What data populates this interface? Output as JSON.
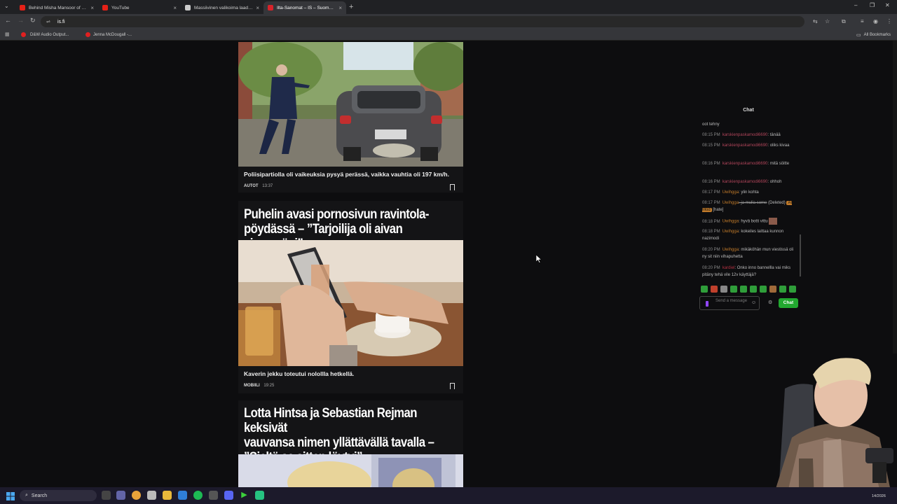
{
  "tabs": [
    {
      "title": "Behind Misha Mansoor of Periphery",
      "favicon_color": "#e62117",
      "active": false
    },
    {
      "title": "YouTube",
      "favicon_color": "#e62117",
      "active": false
    },
    {
      "title": "Massiivinen valikoima laadukkaita",
      "favicon_color": "#cccccc",
      "active": false
    },
    {
      "title": "Ilta-Sanomat – IS – Suomen suurin",
      "favicon_color": "#d8232a",
      "active": true
    }
  ],
  "address": {
    "url": "is.fi"
  },
  "bookmarks": [
    {
      "label": "D&W Audio Output..."
    },
    {
      "label": "Jenna McDougall -..."
    }
  ],
  "bookmarks_all": "All Bookmarks",
  "articles": [
    {
      "caption": "Poliisipartiolla oli vaikeuksia pysyä perässä, vaikka vauhtia oli 197 km/h.",
      "category": "AUTOT",
      "time": "13:37"
    },
    {
      "headline": "Puhelin avasi pornosivun ravintola-pöydässä – ”Tarjoilija oli aivan vieressäni”",
      "headline_line1": "Puhelin avasi pornosivun ravintola-",
      "headline_line2": "pöydässä – ”Tarjoilija oli aivan vieressäni”",
      "caption": "Kaverin jekku toteutui nolollla hetkellä.",
      "category": "MOBIILI",
      "time": "19:25"
    },
    {
      "headline_line1": "Lotta Hintsa ja Sebastian Rejman keksivät",
      "headline_line2": "vauvansa nimen yllättävällä tavalla –",
      "headline_line3": "”Sieltä se sitten löytyi”"
    }
  ],
  "chat": {
    "title": "Chat",
    "messages": [
      {
        "ts": "",
        "user": "",
        "text": "oot tehny"
      },
      {
        "ts": "08:15 PM",
        "user": "karskienpaskamodi6690",
        "text": ": tänää"
      },
      {
        "ts": "08:15 PM",
        "user": "karskienpaskamodi6690",
        "text": ": oliks kivaa"
      },
      {
        "ts": "08:16 PM",
        "user": "karskienpaskamodi6690",
        "text": ": mitä söitte"
      },
      {
        "ts": "08:16 PM",
        "user": "karskienpaskamodi6690",
        "text": ": ohhoh"
      },
      {
        "ts": "08:17 PM",
        "user": "Uwihgga",
        "text": ": ylin kohta"
      },
      {
        "ts": "08:17 PM",
        "user": "Uwihgga",
        "text": ": ja mulla some",
        "deleted": "(Deleted)",
        "badge": "AI Mod",
        "tag": "[hate]"
      },
      {
        "ts": "08:18 PM",
        "user": "Uwihgga",
        "text": ": hyvä botti vittu"
      },
      {
        "ts": "08:18 PM",
        "user": "Uwihgga",
        "text": ": kokeiles laittaa kunnon nazimodi"
      },
      {
        "ts": "08:20 PM",
        "user": "Uwihgga",
        "text": ": mikäköhän mun viestissä oli ny sit niin vihapuhetta"
      },
      {
        "ts": "08:20 PM",
        "user": "kardiel",
        "text": ": Onko inno bannellla vai miks pitäny tehä vile 12v käyttäjä?"
      }
    ],
    "input_placeholder": "Send a message",
    "send_label": "Chat"
  },
  "taskbar": {
    "search_label": "Search",
    "date": "14/2026"
  },
  "colors": {
    "page_bg": "#0d0d0f",
    "card_bg": "#141416",
    "chat_send": "#22a830",
    "taskbar": "#1c1a2b"
  }
}
